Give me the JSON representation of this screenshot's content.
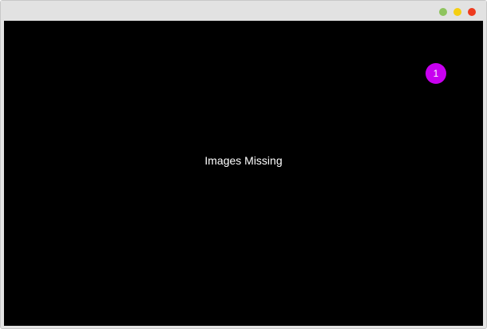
{
  "window": {
    "controls": [
      {
        "name": "green-dot",
        "color": "#8ec45e"
      },
      {
        "name": "yellow-dot",
        "color": "#f5cf12"
      },
      {
        "name": "red-dot",
        "color": "#ee3b1f"
      }
    ]
  },
  "viewport": {
    "background_color": "#000000",
    "message": "Images Missing"
  },
  "badge": {
    "label": "1",
    "color": "#c800f0"
  }
}
